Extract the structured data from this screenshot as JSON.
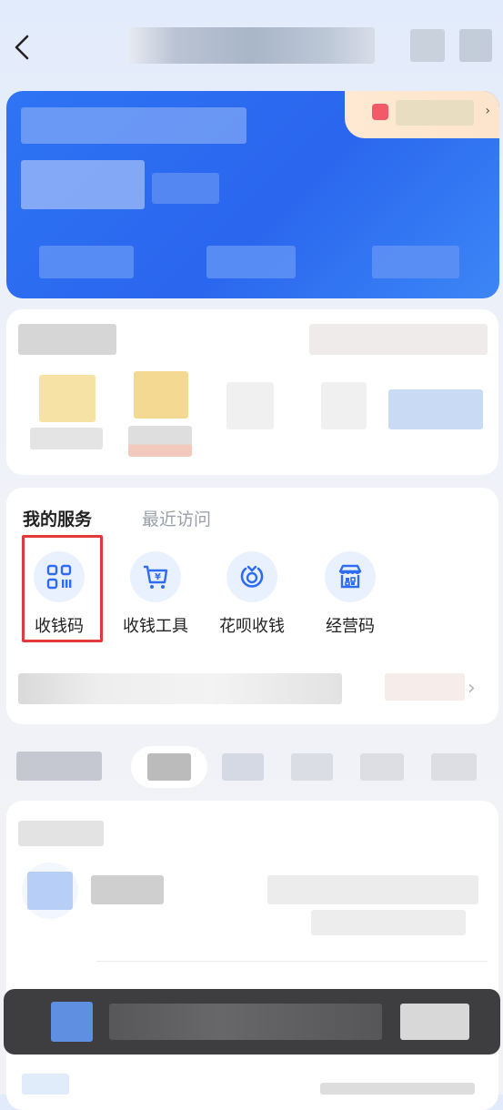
{
  "header": {
    "back_icon": "chevron-left-icon"
  },
  "services": {
    "tabs": [
      {
        "label": "我的服务",
        "active": true
      },
      {
        "label": "最近访问",
        "active": false
      }
    ],
    "items": [
      {
        "label": "收钱码",
        "icon": "qr-code-icon",
        "highlighted": true
      },
      {
        "label": "收钱工具",
        "icon": "cart-yen-icon",
        "highlighted": false
      },
      {
        "label": "花呗收钱",
        "icon": "huabei-icon",
        "highlighted": false
      },
      {
        "label": "经营码",
        "icon": "storefront-qr-icon",
        "highlighted": false
      }
    ]
  },
  "colors": {
    "accent": "#2e6cf5",
    "highlight_border": "#e4393c",
    "promo_bg": "#fde6cf"
  }
}
